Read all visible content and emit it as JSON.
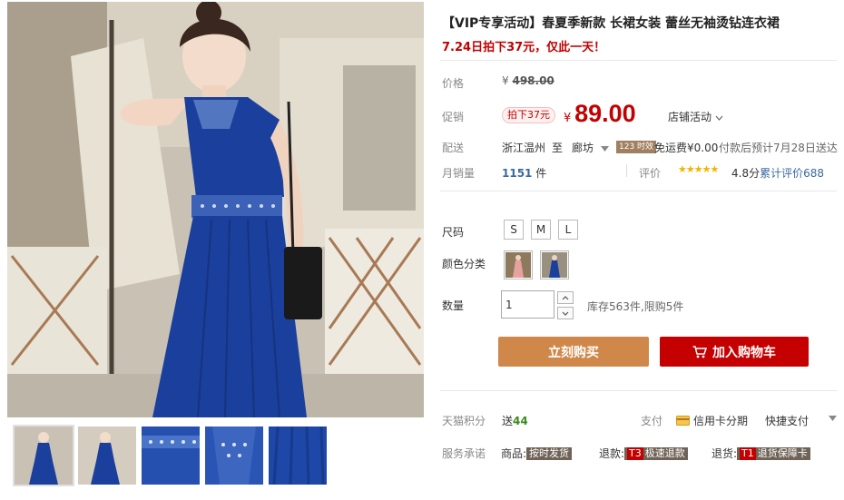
{
  "product": {
    "title": "【VIP专享活动】春夏季新款 长裙女装 蕾丝无袖烫钻连衣裙",
    "subtitle": "7.24日拍下37元，仅此一天！"
  },
  "price": {
    "label": "价格",
    "currency": "¥",
    "original": "498.00",
    "promo_label": "促销",
    "promo_tag": "拍下37元",
    "current": "89.00",
    "shop_promo": "店铺活动"
  },
  "shipping": {
    "label": "配送",
    "origin": "浙江温州",
    "to": "至",
    "destination": "廊坊",
    "badge": "123 时效",
    "fee": "免运费¥0.00",
    "eta": "付款后预计7月28日送达"
  },
  "sales": {
    "label": "月销量",
    "count": "1151",
    "unit": "件",
    "review_label": "评价",
    "rating": "4.8分",
    "review_link": "累计评价688",
    "stars": "★★★★★"
  },
  "sku": {
    "size_label": "尺码",
    "sizes": [
      "S",
      "M",
      "L"
    ],
    "color_label": "颜色分类"
  },
  "quantity": {
    "label": "数量",
    "value": "1",
    "stock": "库存563件,限购5件"
  },
  "actions": {
    "buy_now": "立刻购买",
    "add_to_cart": "加入购物车"
  },
  "points": {
    "label": "天猫积分",
    "prefix": "送",
    "value": "44",
    "pay_label": "支付",
    "credit_card": "信用卡分期",
    "quick_pay": "快捷支付"
  },
  "service": {
    "label": "服务承诺",
    "goods_label": "商品:",
    "goods_tag": "按时发货",
    "refund_label": "退款:",
    "refund_code": "T3",
    "refund_tag": "极速退款",
    "return_label": "退货:",
    "return_code": "T1",
    "return_tag": "退货保障卡"
  },
  "colors": {
    "accent_red": "#c40000",
    "buy_orange": "#d0884a",
    "dress_blue": "#1b3f9c"
  }
}
